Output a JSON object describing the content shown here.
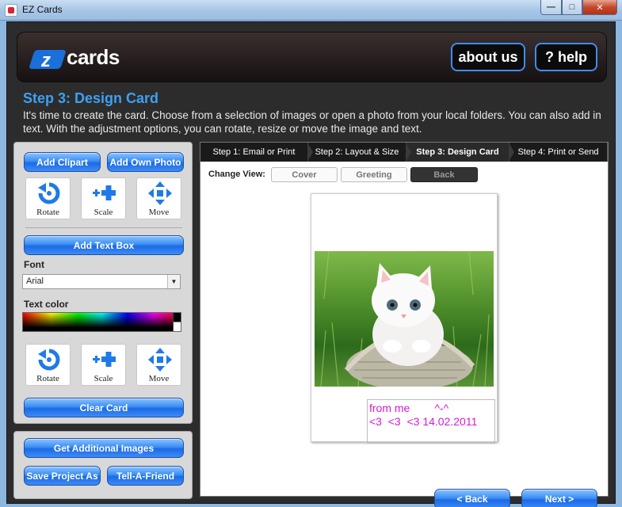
{
  "window": {
    "title": "EZ Cards",
    "controls": {
      "minimize": "—",
      "maximize": "□",
      "close": "✕"
    }
  },
  "header": {
    "logo": {
      "mark": "z",
      "word": "cards"
    },
    "about_label": "about us",
    "help_label": "? help"
  },
  "step": {
    "title": "Step 3: Design Card",
    "intro": "It's time to create the card. Choose from a selection of images or open a photo from your local folders. You can also add in text. With the adjustment options, you can rotate, resize or move the image and text."
  },
  "tools": {
    "add_clipart": "Add Clipart",
    "add_own_photo": "Add Own Photo",
    "image_tiles": [
      {
        "label": "Rotate",
        "icon": "rotate-icon"
      },
      {
        "label": "Scale",
        "icon": "scale-icon"
      },
      {
        "label": "Move",
        "icon": "move-icon"
      }
    ],
    "add_text_box": "Add Text Box",
    "font_label": "Font",
    "font_value": "Arial",
    "text_color_label": "Text color",
    "text_tiles": [
      {
        "label": "Rotate",
        "icon": "rotate-icon"
      },
      {
        "label": "Scale",
        "icon": "scale-icon"
      },
      {
        "label": "Move",
        "icon": "move-icon"
      }
    ],
    "clear_card": "Clear Card"
  },
  "extra": {
    "get_images": "Get Additional Images",
    "save_project": "Save Project As",
    "tell_friend": "Tell-A-Friend"
  },
  "tabs": [
    {
      "label": "Step 1: Email or Print",
      "active": false
    },
    {
      "label": "Step 2: Layout & Size",
      "active": false
    },
    {
      "label": "Step 3: Design Card",
      "active": true
    },
    {
      "label": "Step 4: Print or Send",
      "active": false
    }
  ],
  "change_view": {
    "label": "Change View:",
    "options": [
      {
        "label": "Cover",
        "active": false
      },
      {
        "label": "Greeting",
        "active": false
      },
      {
        "label": "Back",
        "active": true
      }
    ]
  },
  "card": {
    "text": "from me        ^-^\n<3  <3  <3 14.02.2011",
    "text_color": "#d61ad6"
  },
  "nav": {
    "back": "< Back",
    "next": "Next >"
  },
  "colors": {
    "accent_blue": "#3ea0f2",
    "frame": "#2c2c2c",
    "button_blue": "#1c6ae6"
  }
}
